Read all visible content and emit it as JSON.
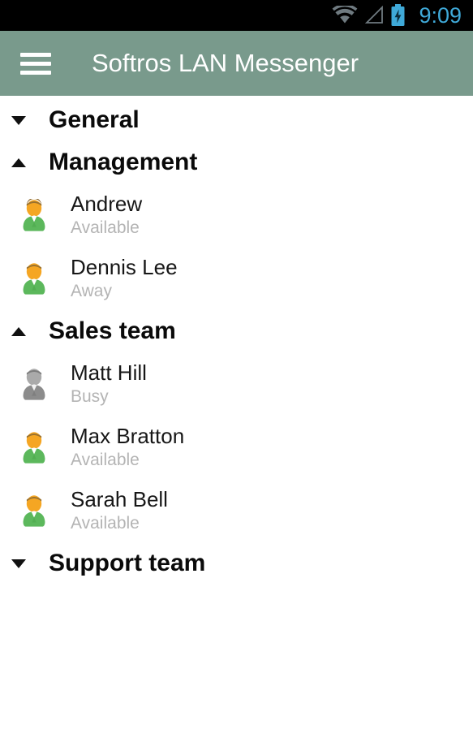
{
  "status_bar": {
    "time": "9:09",
    "time_color": "#3fa9d8",
    "background": "#000000",
    "icons": [
      "wifi-icon",
      "cell-signal-icon",
      "battery-charging-icon"
    ],
    "wifi_color": "#6f7a80",
    "signal_color": "#6f7a80",
    "battery_color": "#3fa9d8"
  },
  "app_bar": {
    "title": "Softros LAN Messenger",
    "menu_icon": "hamburger-menu-icon",
    "background": "#799a8c",
    "text_color": "#ffffff"
  },
  "contact_list": {
    "groups": [
      {
        "name": "General",
        "expanded": false,
        "arrow": "chevron-down-icon",
        "contacts": []
      },
      {
        "name": "Management",
        "expanded": true,
        "arrow": "chevron-up-icon",
        "contacts": [
          {
            "name": "Andrew",
            "status": "Available",
            "avatar": "user-avatar-online-icon"
          },
          {
            "name": "Dennis Lee",
            "status": "Away",
            "avatar": "user-avatar-online-icon"
          }
        ]
      },
      {
        "name": "Sales team",
        "expanded": true,
        "arrow": "chevron-up-icon",
        "contacts": [
          {
            "name": "Matt Hill",
            "status": "Busy",
            "avatar": "user-avatar-busy-icon"
          },
          {
            "name": "Max Bratton",
            "status": "Available",
            "avatar": "user-avatar-online-icon"
          },
          {
            "name": "Sarah Bell",
            "status": "Available",
            "avatar": "user-avatar-online-icon"
          }
        ]
      },
      {
        "name": "Support team",
        "expanded": false,
        "arrow": "chevron-down-icon",
        "contacts": []
      }
    ],
    "status_text_color": "#b4b4b4",
    "name_text_color": "#171717",
    "group_text_color": "#0a0a0a"
  }
}
